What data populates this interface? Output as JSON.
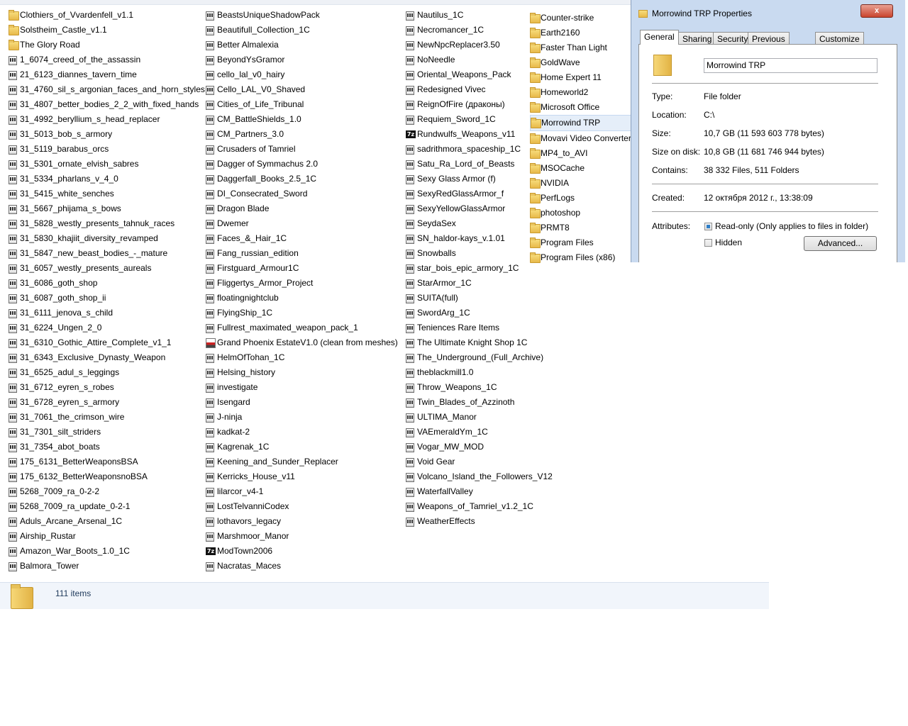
{
  "explorer": {
    "columns": [
      [
        {
          "icon": "folder",
          "name": "Clothiers_of_Vvardenfell_v1.1"
        },
        {
          "icon": "folder",
          "name": "Solstheim_Castle_v1.1"
        },
        {
          "icon": "folder",
          "name": "The Glory Road"
        },
        {
          "icon": "archive",
          "name": "1_6074_creed_of_the_assassin"
        },
        {
          "icon": "archive",
          "name": "21_6123_diannes_tavern_time"
        },
        {
          "icon": "archive",
          "name": "31_4760_sil_s_argonian_faces_and_horn_styles"
        },
        {
          "icon": "archive",
          "name": "31_4807_better_bodies_2_2_with_fixed_hands"
        },
        {
          "icon": "archive",
          "name": "31_4992_beryllium_s_head_replacer"
        },
        {
          "icon": "archive",
          "name": "31_5013_bob_s_armory"
        },
        {
          "icon": "archive",
          "name": "31_5119_barabus_orcs"
        },
        {
          "icon": "archive",
          "name": "31_5301_ornate_elvish_sabres"
        },
        {
          "icon": "archive",
          "name": "31_5334_pharlans_v_4_0"
        },
        {
          "icon": "archive",
          "name": "31_5415_white_senches"
        },
        {
          "icon": "archive",
          "name": "31_5667_phijama_s_bows"
        },
        {
          "icon": "archive",
          "name": "31_5828_westly_presents_tahnuk_races"
        },
        {
          "icon": "archive",
          "name": "31_5830_khajiit_diversity_revamped"
        },
        {
          "icon": "archive",
          "name": "31_5847_new_beast_bodies_-_mature"
        },
        {
          "icon": "archive",
          "name": "31_6057_westly_presents_aureals"
        },
        {
          "icon": "archive",
          "name": "31_6086_goth_shop"
        },
        {
          "icon": "archive",
          "name": "31_6087_goth_shop_ii"
        },
        {
          "icon": "archive",
          "name": "31_6111_jenova_s_child"
        },
        {
          "icon": "archive",
          "name": "31_6224_Ungen_2_0"
        },
        {
          "icon": "archive",
          "name": "31_6310_Gothic_Attire_Complete_v1_1"
        },
        {
          "icon": "archive",
          "name": "31_6343_Exclusive_Dynasty_Weapon"
        },
        {
          "icon": "archive",
          "name": "31_6525_adul_s_leggings"
        },
        {
          "icon": "archive",
          "name": "31_6712_eyren_s_robes"
        },
        {
          "icon": "archive",
          "name": "31_6728_eyren_s_armory"
        },
        {
          "icon": "archive",
          "name": "31_7061_the_crimson_wire"
        },
        {
          "icon": "archive",
          "name": "31_7301_silt_striders"
        },
        {
          "icon": "archive",
          "name": "31_7354_abot_boats"
        },
        {
          "icon": "archive",
          "name": "175_6131_BetterWeaponsBSA"
        },
        {
          "icon": "archive",
          "name": "175_6132_BetterWeaponsnoBSA"
        },
        {
          "icon": "archive",
          "name": "5268_7009_ra_0-2-2"
        },
        {
          "icon": "archive",
          "name": "5268_7009_ra_update_0-2-1"
        },
        {
          "icon": "archive",
          "name": "Aduls_Arcane_Arsenal_1C"
        },
        {
          "icon": "archive",
          "name": "Airship_Rustar"
        },
        {
          "icon": "archive",
          "name": "Amazon_War_Boots_1.0_1C"
        },
        {
          "icon": "archive",
          "name": "Balmora_Tower"
        }
      ],
      [
        {
          "icon": "archive",
          "name": "BeastsUniqueShadowPack"
        },
        {
          "icon": "archive",
          "name": "Beautifull_Collection_1C"
        },
        {
          "icon": "archive",
          "name": "Better Almalexia"
        },
        {
          "icon": "archive",
          "name": "BeyondYsGramor"
        },
        {
          "icon": "archive",
          "name": "cello_lal_v0_hairy"
        },
        {
          "icon": "archive",
          "name": "Cello_LAL_V0_Shaved"
        },
        {
          "icon": "archive",
          "name": "Cities_of_Life_Tribunal"
        },
        {
          "icon": "archive",
          "name": "CM_BattleShields_1.0"
        },
        {
          "icon": "archive",
          "name": "CM_Partners_3.0"
        },
        {
          "icon": "archive",
          "name": "Crusaders of Tamriel"
        },
        {
          "icon": "archive",
          "name": "Dagger of Symmachus 2.0"
        },
        {
          "icon": "archive",
          "name": "Daggerfall_Books_2.5_1C"
        },
        {
          "icon": "archive",
          "name": "DI_Consecrated_Sword"
        },
        {
          "icon": "archive",
          "name": "Dragon Blade"
        },
        {
          "icon": "archive",
          "name": "Dwemer"
        },
        {
          "icon": "archive",
          "name": "Faces_&_Hair_1C"
        },
        {
          "icon": "archive",
          "name": "Fang_russian_edition"
        },
        {
          "icon": "archive",
          "name": "Firstguard_Armour1C"
        },
        {
          "icon": "archive",
          "name": "Fliggertys_Armor_Project"
        },
        {
          "icon": "archive",
          "name": "floatingnightclub"
        },
        {
          "icon": "archive",
          "name": "FlyingShip_1C"
        },
        {
          "icon": "archive",
          "name": "Fullrest_maximated_weapon_pack_1"
        },
        {
          "icon": "setup",
          "name": "Grand Phoenix EstateV1.0 (clean from meshes)"
        },
        {
          "icon": "archive",
          "name": "HelmOfTohan_1C"
        },
        {
          "icon": "archive",
          "name": "Helsing_history"
        },
        {
          "icon": "archive",
          "name": "investigate"
        },
        {
          "icon": "archive",
          "name": "Isengard"
        },
        {
          "icon": "archive",
          "name": "J-ninja"
        },
        {
          "icon": "archive",
          "name": "kadkat-2"
        },
        {
          "icon": "archive",
          "name": "Kagrenak_1C"
        },
        {
          "icon": "archive",
          "name": "Keening_and_Sunder_Replacer"
        },
        {
          "icon": "archive",
          "name": "Kerricks_House_v11"
        },
        {
          "icon": "archive",
          "name": "lilarcor_v4-1"
        },
        {
          "icon": "archive",
          "name": "LostTelvanniCodex"
        },
        {
          "icon": "archive",
          "name": "lothavors_legacy"
        },
        {
          "icon": "archive",
          "name": "Marshmoor_Manor"
        },
        {
          "icon": "7z",
          "name": "ModTown2006"
        },
        {
          "icon": "archive",
          "name": "Nacratas_Maces"
        }
      ],
      [
        {
          "icon": "archive",
          "name": "Nautilus_1C"
        },
        {
          "icon": "archive",
          "name": "Necromancer_1C"
        },
        {
          "icon": "archive",
          "name": "NewNpcReplacer3.50"
        },
        {
          "icon": "archive",
          "name": "NoNeedle"
        },
        {
          "icon": "archive",
          "name": "Oriental_Weapons_Pack"
        },
        {
          "icon": "archive",
          "name": "Redesigned Vivec"
        },
        {
          "icon": "archive",
          "name": "ReignOfFire (драконы)"
        },
        {
          "icon": "archive",
          "name": "Requiem_Sword_1C"
        },
        {
          "icon": "7z",
          "name": "Rundwulfs_Weapons_v11"
        },
        {
          "icon": "archive",
          "name": "sadrithmora_spaceship_1C"
        },
        {
          "icon": "archive",
          "name": "Satu_Ra_Lord_of_Beasts"
        },
        {
          "icon": "archive",
          "name": "Sexy Glass Armor (f)"
        },
        {
          "icon": "archive",
          "name": "SexyRedGlassArmor_f"
        },
        {
          "icon": "archive",
          "name": "SexyYellowGlassArmor"
        },
        {
          "icon": "archive",
          "name": "SeydaSex"
        },
        {
          "icon": "archive",
          "name": "SN_haldor-kays_v.1.01"
        },
        {
          "icon": "archive",
          "name": "Snowballs"
        },
        {
          "icon": "archive",
          "name": "star_bois_epic_armory_1C"
        },
        {
          "icon": "archive",
          "name": "StarArmor_1C"
        },
        {
          "icon": "archive",
          "name": "SUITA(full)"
        },
        {
          "icon": "archive",
          "name": "SwordArg_1C"
        },
        {
          "icon": "archive",
          "name": "Teniences Rare Items"
        },
        {
          "icon": "archive",
          "name": "The Ultimate Knight Shop 1C"
        },
        {
          "icon": "archive",
          "name": "The_Underground_(Full_Archive)"
        },
        {
          "icon": "archive",
          "name": "theblackmill1.0"
        },
        {
          "icon": "archive",
          "name": "Throw_Weapons_1C"
        },
        {
          "icon": "archive",
          "name": "Twin_Blades_of_Azzinoth"
        },
        {
          "icon": "archive",
          "name": "ULTIMA_Manor"
        },
        {
          "icon": "archive",
          "name": "VAEmeraldYm_1C"
        },
        {
          "icon": "archive",
          "name": "Vogar_MW_MOD"
        },
        {
          "icon": "archive",
          "name": "Void Gear"
        },
        {
          "icon": "archive",
          "name": "Volcano_Island_the_Followers_V12"
        },
        {
          "icon": "archive",
          "name": "WaterfallValley"
        },
        {
          "icon": "archive",
          "name": "Weapons_of_Tamriel_v1.2_1C"
        },
        {
          "icon": "archive",
          "name": "WeatherEffects"
        }
      ]
    ],
    "drive_folders": [
      {
        "name": "Counter-strike",
        "selected": false
      },
      {
        "name": "Earth2160",
        "selected": false
      },
      {
        "name": "Faster Than Light",
        "selected": false
      },
      {
        "name": "GoldWave",
        "selected": false
      },
      {
        "name": "Home Expert 11",
        "selected": false
      },
      {
        "name": "Homeworld2",
        "selected": false
      },
      {
        "name": "Microsoft Office",
        "selected": false
      },
      {
        "name": "Morrowind TRP",
        "selected": true
      },
      {
        "name": "Movavi Video Converter",
        "selected": false
      },
      {
        "name": "MP4_to_AVI",
        "selected": false
      },
      {
        "name": "MSOCache",
        "selected": false
      },
      {
        "name": "NVIDIA",
        "selected": false
      },
      {
        "name": "PerfLogs",
        "selected": false
      },
      {
        "name": "photoshop",
        "selected": false
      },
      {
        "name": "PRMT8",
        "selected": false
      },
      {
        "name": "Program Files",
        "selected": false
      },
      {
        "name": "Program Files (x86)",
        "selected": false
      }
    ],
    "status": {
      "item_count": "111 items"
    }
  },
  "dialog": {
    "title": "Morrowind TRP Properties",
    "close_label": "x",
    "tabs": [
      "General",
      "Sharing",
      "Security",
      "Previous Versions",
      "Customize"
    ],
    "active_tab": "General",
    "folder_name": "Morrowind TRP",
    "type_label": "Type:",
    "type_value": "File folder",
    "location_label": "Location:",
    "location_value": "C:\\",
    "size_label": "Size:",
    "size_value": "10,7 GB (11 593 603 778 bytes)",
    "size_on_disk_label": "Size on disk:",
    "size_on_disk_value": "10,8 GB (11 681 746 944 bytes)",
    "contains_label": "Contains:",
    "contains_value": "38 332 Files, 511 Folders",
    "created_label": "Created:",
    "created_value": "12 октября 2012 г., 13:38:09",
    "attributes_label": "Attributes:",
    "readonly_label": "Read-only (Only applies to files in folder)",
    "readonly_state": "mixed",
    "hidden_label": "Hidden",
    "hidden_checked": false,
    "advanced_label": "Advanced..."
  }
}
